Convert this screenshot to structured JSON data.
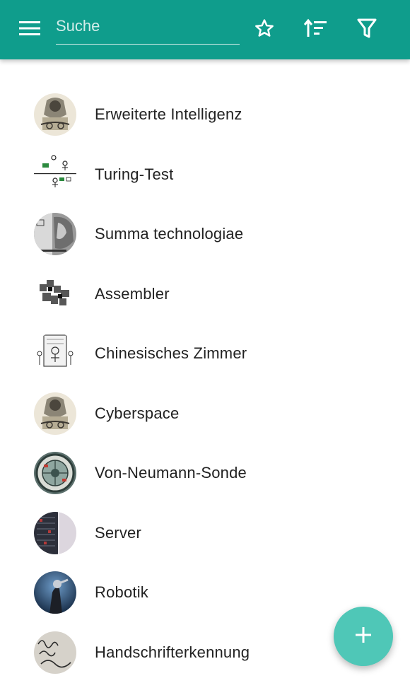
{
  "appbar": {
    "background": "#0f9d8c",
    "menu_icon": "menu-icon",
    "search": {
      "placeholder": "Suche",
      "value": ""
    },
    "actions": [
      "star-icon",
      "sort-icon",
      "filter-icon"
    ]
  },
  "list": {
    "items": [
      {
        "label": "Erweiterte Intelligenz",
        "icon": "engraving-thumbnail"
      },
      {
        "label": "Turing-Test",
        "icon": "turing-test-diagram-thumbnail"
      },
      {
        "label": "Summa technologiae",
        "icon": "book-cover-thumbnail"
      },
      {
        "label": "Assembler",
        "icon": "pixel-pattern-thumbnail"
      },
      {
        "label": "Chinesisches Zimmer",
        "icon": "sketch-thumbnail"
      },
      {
        "label": "Cyberspace",
        "icon": "engraving-thumbnail"
      },
      {
        "label": "Von-Neumann-Sonde",
        "icon": "probe-thumbnail"
      },
      {
        "label": "Server",
        "icon": "server-rack-thumbnail"
      },
      {
        "label": "Robotik",
        "icon": "robot-thumbnail"
      },
      {
        "label": "Handschrifterkennung",
        "icon": "handwriting-thumbnail"
      }
    ]
  },
  "fab": {
    "icon": "plus-icon",
    "color": "#4fc7b7"
  }
}
